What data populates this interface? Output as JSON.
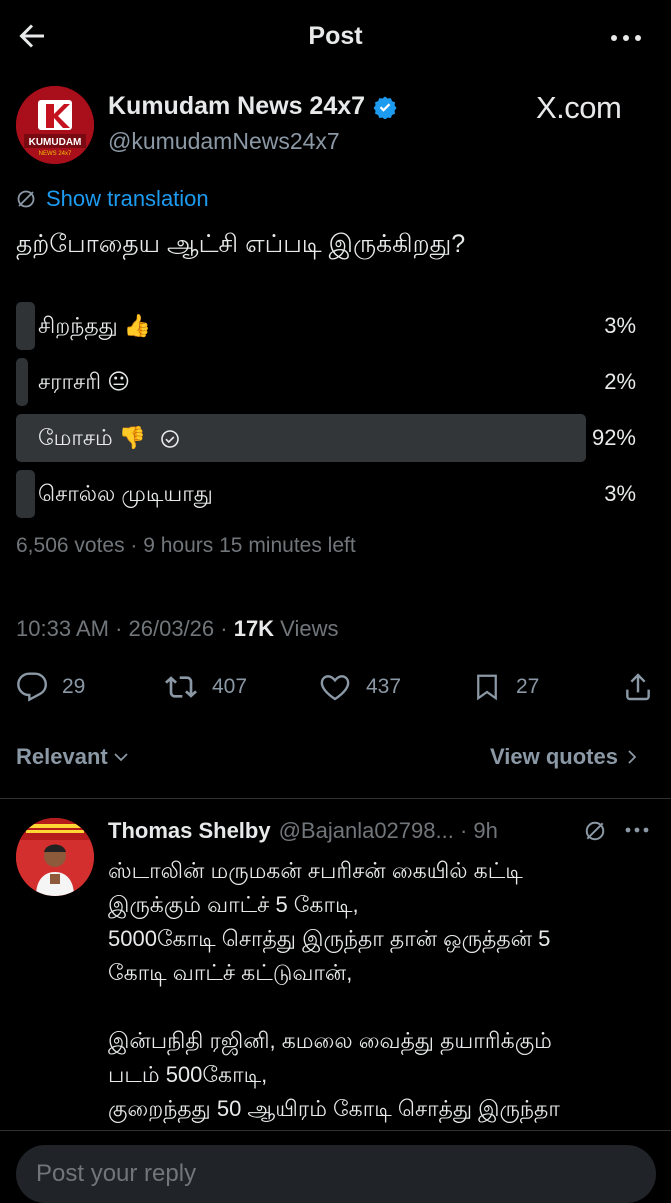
{
  "topbar": {
    "title": "Post"
  },
  "post": {
    "author_name": "Kumudam News 24x7",
    "author_handle": "@kumudamNews24x7",
    "watermark": "X.com",
    "show_translation": "Show translation",
    "question": "தற்போதைய ஆட்சி எப்படி இருக்கிறது?",
    "avatar_text": "KUMUDAM",
    "avatar_subtext": "NEWS 24x7",
    "poll": {
      "options": [
        {
          "label": "சிறந்தது 👍",
          "percent_text": "3%",
          "percent": 3
        },
        {
          "label": "சராசரி 😐",
          "percent_text": "2%",
          "percent": 2
        },
        {
          "label": "மோசம் 👎",
          "percent_text": "92%",
          "percent": 92,
          "selected": true
        },
        {
          "label": "சொல்ல முடியாது",
          "percent_text": "3%",
          "percent": 3
        }
      ],
      "meta": "6,506 votes · 9 hours 15 minutes left"
    },
    "timestamp": "10:33 AM · 26/03/26 · ",
    "views_count": "17K",
    "views_label": " Views",
    "actions": {
      "replies": "29",
      "reposts": "407",
      "likes": "437",
      "bookmarks": "27"
    }
  },
  "filter": {
    "relevant": "Relevant",
    "view_quotes": "View quotes"
  },
  "reply": {
    "name": "Thomas Shelby",
    "handle": "@Bajanla02798... · 9h",
    "lines": [
      "ஸ்டாலின் மருமகன் சபரிசன் கையில் கட்டி",
      "இருக்கும் வாட்ச் 5 கோடி,",
      "5000கோடி சொத்து இருந்தா தான் ஒருத்தன் 5",
      "கோடி வாட்ச் கட்டுவான்,",
      "",
      "இன்பநிதி ரஜினி, கமலை வைத்து தயாரிக்கும்",
      "படம் 500கோடி,",
      "குறைந்தது 50 ஆயிரம் கோடி சொத்து இருந்தா"
    ]
  },
  "reply_input": {
    "placeholder": "Post your reply"
  },
  "colors": {
    "accent": "#1d9bf0",
    "verified": "#1d9bf0",
    "poll_fill": "#333639",
    "muted": "#71767b"
  }
}
